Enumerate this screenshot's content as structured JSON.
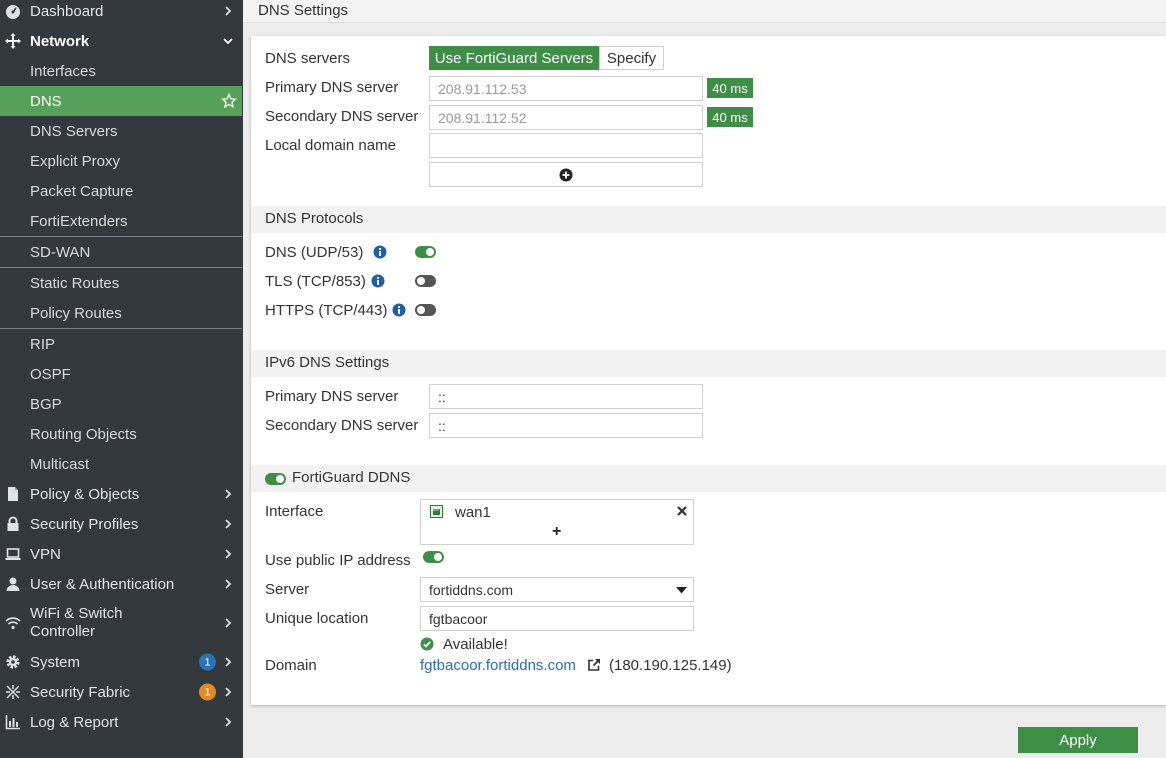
{
  "sidebar": {
    "items": [
      {
        "label": "Dashboard"
      },
      {
        "label": "Network"
      },
      {
        "label": "Interfaces"
      },
      {
        "label": "DNS"
      },
      {
        "label": "DNS Servers"
      },
      {
        "label": "Explicit Proxy"
      },
      {
        "label": "Packet Capture"
      },
      {
        "label": "FortiExtenders"
      },
      {
        "label": "SD-WAN"
      },
      {
        "label": "Static Routes"
      },
      {
        "label": "Policy Routes"
      },
      {
        "label": "RIP"
      },
      {
        "label": "OSPF"
      },
      {
        "label": "BGP"
      },
      {
        "label": "Routing Objects"
      },
      {
        "label": "Multicast"
      },
      {
        "label": "Policy & Objects"
      },
      {
        "label": "Security Profiles"
      },
      {
        "label": "VPN"
      },
      {
        "label": "User & Authentication"
      },
      {
        "label": "WiFi & Switch Controller"
      },
      {
        "label": "System",
        "badge": "1"
      },
      {
        "label": "Security Fabric",
        "badge": "1"
      },
      {
        "label": "Log & Report"
      }
    ]
  },
  "header": {
    "title": "DNS Settings"
  },
  "dns": {
    "servers_label": "DNS servers",
    "use_fortiguard": "Use FortiGuard Servers",
    "specify": "Specify",
    "primary_label": "Primary DNS server",
    "primary_value": "208.91.112.53",
    "primary_latency": "40 ms",
    "secondary_label": "Secondary DNS server",
    "secondary_value": "208.91.112.52",
    "secondary_latency": "40 ms",
    "local_domain_label": "Local domain name",
    "local_domain_value": ""
  },
  "protocols": {
    "title": "DNS Protocols",
    "udp": "DNS (UDP/53)",
    "tls": "TLS (TCP/853)",
    "https": "HTTPS (TCP/443)"
  },
  "ipv6": {
    "title": "IPv6 DNS Settings",
    "primary_label": "Primary DNS server",
    "primary_value": "::",
    "secondary_label": "Secondary DNS server",
    "secondary_value": "::"
  },
  "ddns": {
    "title": "FortiGuard DDNS",
    "interface_label": "Interface",
    "interface_value": "wan1",
    "add_symbol": "+",
    "public_ip_label": "Use public IP address",
    "server_label": "Server",
    "server_value": "fortiddns.com",
    "unique_label": "Unique location",
    "unique_value": "fgtbacoor",
    "available": "Available!",
    "domain_label": "Domain",
    "domain_link": "fgtbacoor.fortiddns.com",
    "domain_ip": "(180.190.125.149)"
  },
  "apply_label": "Apply",
  "colors": {
    "accent": "#3e8e48",
    "sidebar": "#34393e",
    "active": "#56a05a"
  }
}
